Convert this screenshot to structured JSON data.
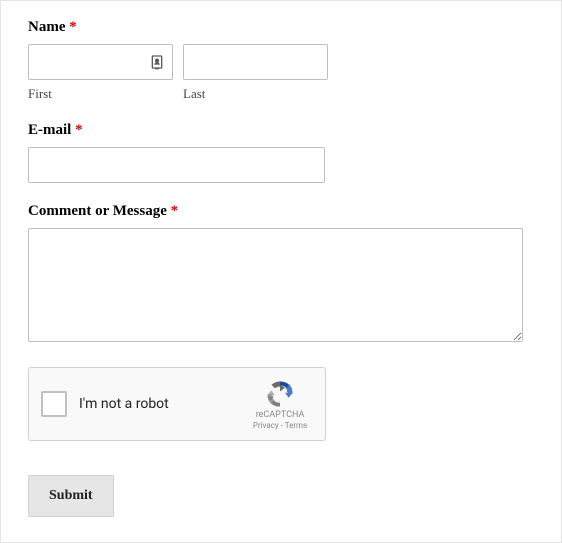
{
  "name": {
    "label": "Name",
    "required": "*",
    "first_label": "First",
    "last_label": "Last"
  },
  "email": {
    "label": "E-mail",
    "required": "*"
  },
  "comment": {
    "label": "Comment or Message",
    "required": "*"
  },
  "recaptcha": {
    "label": "I'm not a robot",
    "brand": "reCAPTCHA",
    "privacy": "Privacy",
    "separator": " - ",
    "terms": "Terms"
  },
  "submit": {
    "label": "Submit"
  }
}
